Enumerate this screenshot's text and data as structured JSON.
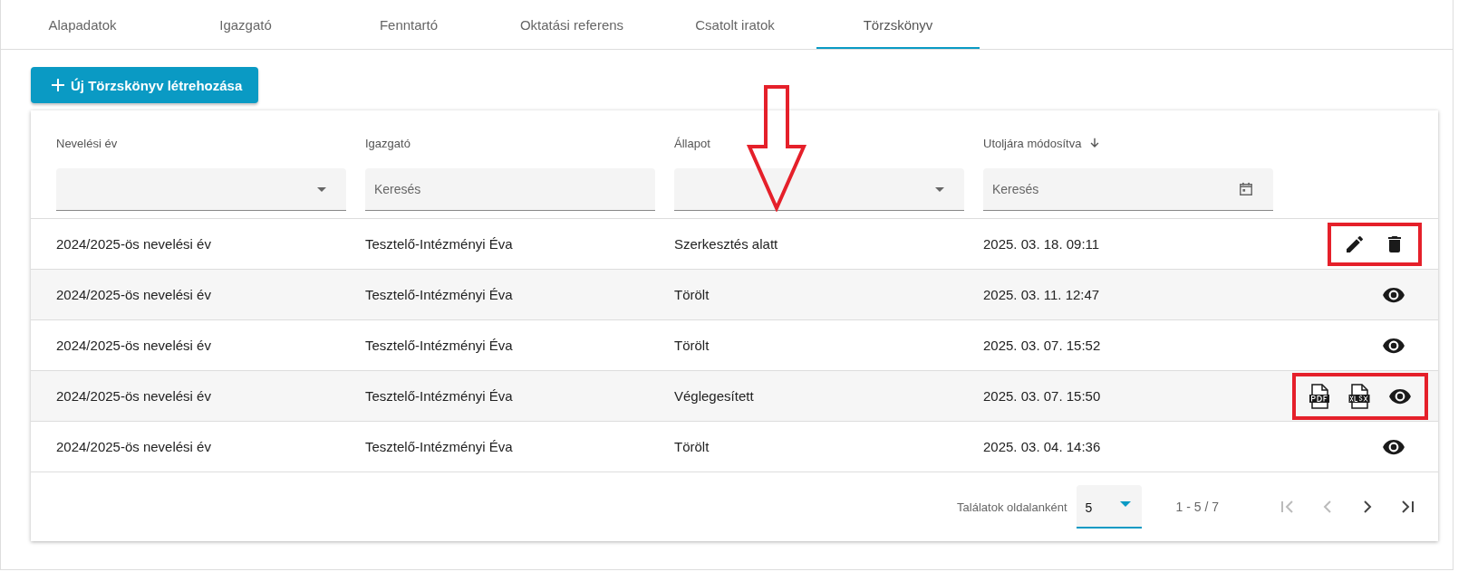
{
  "tabs": [
    {
      "label": "Alapadatok",
      "selected": false
    },
    {
      "label": "Igazgató",
      "selected": false
    },
    {
      "label": "Fenntartó",
      "selected": false
    },
    {
      "label": "Oktatási referens",
      "selected": false
    },
    {
      "label": "Csatolt iratok",
      "selected": false
    },
    {
      "label": "Törzskönyv",
      "selected": true
    }
  ],
  "create_button": {
    "label": "Új Törzskönyv létrehozása"
  },
  "table": {
    "columns": [
      {
        "label": "Nevelési év",
        "filter": {
          "kind": "select"
        },
        "sorted": false,
        "arrow_annotation": false
      },
      {
        "label": "Igazgató",
        "filter": {
          "kind": "text",
          "placeholder": "Keresés"
        },
        "sorted": false,
        "arrow_annotation": false
      },
      {
        "label": "Állapot",
        "filter": {
          "kind": "select"
        },
        "sorted": false,
        "arrow_annotation": true
      },
      {
        "label": "Utoljára módosítva",
        "filter": {
          "kind": "date",
          "placeholder": "Keresés"
        },
        "sorted": true,
        "arrow_annotation": false
      }
    ],
    "rows": [
      {
        "cells": [
          "2024/2025-ös nevelési év",
          "Tesztelő-Intézményi Éva",
          "Szerkesztés alatt",
          "2025. 03. 18. 09:11"
        ],
        "actions": [
          {
            "kind": "edit"
          },
          {
            "kind": "delete"
          }
        ],
        "highlighted": true
      },
      {
        "cells": [
          "2024/2025-ös nevelési év",
          "Tesztelő-Intézményi Éva",
          "Törölt",
          "2025. 03. 11. 12:47"
        ],
        "actions": [
          {
            "kind": "view"
          }
        ],
        "highlighted": false
      },
      {
        "cells": [
          "2024/2025-ös nevelési év",
          "Tesztelő-Intézményi Éva",
          "Törölt",
          "2025. 03. 07. 15:52"
        ],
        "actions": [
          {
            "kind": "view"
          }
        ],
        "highlighted": false
      },
      {
        "cells": [
          "2024/2025-ös nevelési év",
          "Tesztelő-Intézményi Éva",
          "Véglegesített",
          "2025. 03. 07. 15:50"
        ],
        "actions": [
          {
            "kind": "pdf"
          },
          {
            "kind": "xlsx"
          },
          {
            "kind": "view"
          }
        ],
        "highlighted": true
      },
      {
        "cells": [
          "2024/2025-ös nevelési év",
          "Tesztelő-Intézményi Éva",
          "Törölt",
          "2025. 03. 04. 14:36"
        ],
        "actions": [
          {
            "kind": "view"
          }
        ],
        "highlighted": false
      }
    ]
  },
  "pagination": {
    "label": "Találatok oldalanként",
    "page_size": "5",
    "range": "1 - 5 / 7",
    "first_disabled": true,
    "prev_disabled": true,
    "next_disabled": false,
    "last_disabled": false
  }
}
